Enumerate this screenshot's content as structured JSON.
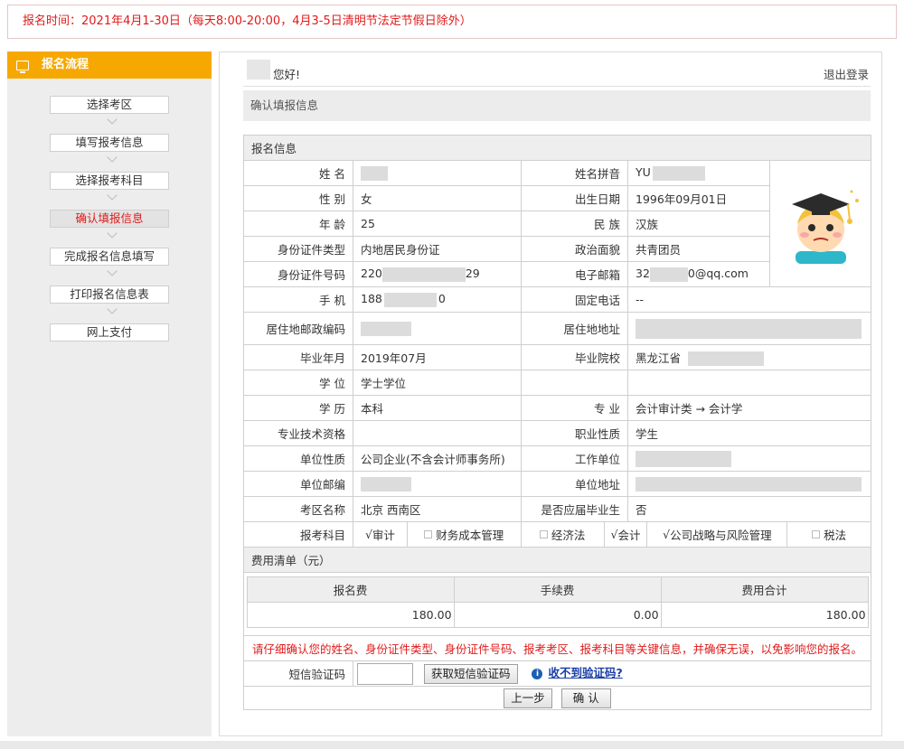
{
  "notice": "报名时间：2021年4月1-30日（每天8:00-20:00，4月3-5日清明节法定节假日除外）",
  "sidebar": {
    "title": "报名流程",
    "steps": [
      {
        "label": "选择考区"
      },
      {
        "label": "填写报考信息"
      },
      {
        "label": "选择报考科目"
      },
      {
        "label": "确认填报信息",
        "active": true
      },
      {
        "label": "完成报名信息填写"
      },
      {
        "label": "打印报名信息表"
      },
      {
        "label": "网上支付"
      }
    ]
  },
  "header": {
    "greeting": "您好!",
    "logout": "退出登录",
    "section_title": "确认填报信息"
  },
  "info": {
    "section": "报名信息",
    "name_label": "姓 名",
    "pinyin_label": "姓名拼音",
    "pinyin_value": "YU",
    "gender_label": "性 别",
    "gender_value": "女",
    "birth_label": "出生日期",
    "birth_value": "1996年09月01日",
    "age_label": "年 龄",
    "age_value": "25",
    "ethnic_label": "民 族",
    "ethnic_value": "汉族",
    "idtype_label": "身份证件类型",
    "idtype_value": "内地居民身份证",
    "politic_label": "政治面貌",
    "politic_value": "共青团员",
    "idno_label": "身份证件号码",
    "idno_prefix": "220",
    "idno_suffix": "29",
    "email_label": "电子邮箱",
    "email_prefix": "32",
    "email_suffix": "0@qq.com",
    "phone_label": "手 机",
    "phone_prefix": "188",
    "phone_suffix": "0",
    "tel_label": "固定电话",
    "tel_value": "--",
    "zip_label": "居住地邮政编码",
    "addr_label": "居住地地址",
    "gradym_label": "毕业年月",
    "gradym_value": "2019年07月",
    "school_label": "毕业院校",
    "school_value": "黑龙江省",
    "degree_label": "学 位",
    "degree_value": "学士学位",
    "edu_label": "学 历",
    "edu_value": "本科",
    "major_label": "专 业",
    "major_value": "会计审计类 → 会计学",
    "qual_label": "专业技术资格",
    "job_label": "职业性质",
    "job_value": "学生",
    "unit_type_label": "单位性质",
    "unit_type_value": "公司企业(不含会计师事务所)",
    "unit_label": "工作单位",
    "unit_zip_label": "单位邮编",
    "unit_addr_label": "单位地址",
    "area_label": "考区名称",
    "area_value": "北京 西南区",
    "fresh_label": "是否应届毕业生",
    "fresh_value": "否",
    "subjects_label": "报考科目",
    "subjects": [
      {
        "name": "审计",
        "checked": true
      },
      {
        "name": "财务成本管理",
        "checked": false
      },
      {
        "name": "经济法",
        "checked": false
      },
      {
        "name": "会计",
        "checked": true
      },
      {
        "name": "公司战略与风险管理",
        "checked": true
      },
      {
        "name": "税法",
        "checked": false
      }
    ],
    "check_mark": "√"
  },
  "fees": {
    "section": "费用清单（元）",
    "headers": [
      "报名费",
      "手续费",
      "费用合计"
    ],
    "values": [
      "180.00",
      "0.00",
      "180.00"
    ]
  },
  "warning": "请仔细确认您的姓名、身份证件类型、身份证件号码、报考考区、报考科目等关键信息，并确保无误，以免影响您的报名。",
  "sms": {
    "label": "短信验证码",
    "get_button": "获取短信验证码",
    "help_icon": "i",
    "help_link": "收不到验证码?"
  },
  "buttons": {
    "prev": "上一步",
    "confirm": "确 认"
  },
  "colors": {
    "accent": "#f7a800",
    "warning": "#e01b1b",
    "link": "#1a3ea8"
  }
}
